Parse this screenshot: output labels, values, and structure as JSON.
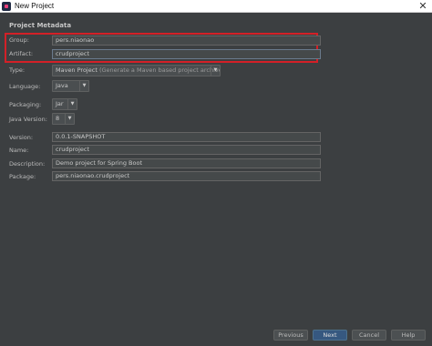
{
  "window": {
    "title": "New Project",
    "close_glyph": "✕"
  },
  "section_title": "Project Metadata",
  "fields": {
    "group": {
      "label": "Group:",
      "value": "pers.niaonao"
    },
    "artifact": {
      "label": "Artifact:",
      "value": "crudproject"
    },
    "type": {
      "label": "Type:",
      "value": "Maven Project",
      "hint": "(Generate a Maven based project archive)"
    },
    "language": {
      "label": "Language:",
      "value": "Java"
    },
    "packaging": {
      "label": "Packaging:",
      "value": "Jar"
    },
    "java_version": {
      "label": "Java Version:",
      "value": "8"
    },
    "version": {
      "label": "Version:",
      "value": "0.0.1-SNAPSHOT"
    },
    "name": {
      "label": "Name:",
      "value": "crudproject"
    },
    "description": {
      "label": "Description:",
      "value": "Demo project for Spring Boot"
    },
    "package": {
      "label": "Package:",
      "value": "pers.niaonao.crudproject"
    }
  },
  "buttons": {
    "previous": "Previous",
    "next": "Next",
    "cancel": "Cancel",
    "help": "Help"
  },
  "icons": {
    "app": "intellij-app-icon",
    "close": "close-icon",
    "dropdown": "chevron-down-icon"
  },
  "colors": {
    "background": "#3c3f41",
    "field_bg": "#45494a",
    "highlight": "#d32027",
    "primary_button": "#365880"
  }
}
